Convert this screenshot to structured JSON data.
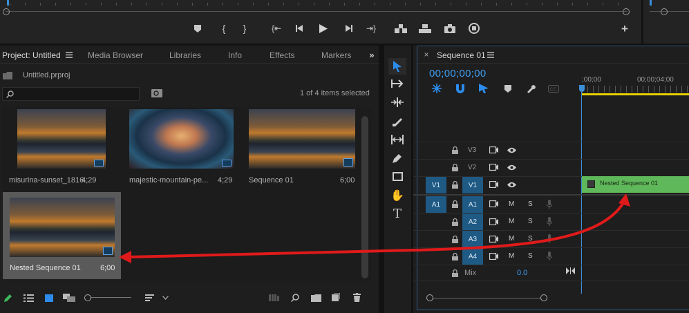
{
  "program_monitor": {
    "transport_icons": [
      "marker-icon",
      "mark-in-icon",
      "mark-out-icon",
      "go-to-in-icon",
      "step-back-icon",
      "play-icon",
      "step-forward-icon",
      "go-to-out-icon",
      "insert-icon",
      "overwrite-icon",
      "export-frame-icon",
      "comparison-view-icon",
      "add-button-icon"
    ]
  },
  "project_panel": {
    "tabs": [
      "Project: Untitled",
      "Media Browser",
      "Libraries",
      "Info",
      "Effects",
      "Markers"
    ],
    "file_name": "Untitled.prproj",
    "search_placeholder": "",
    "selection_status": "1 of 4 items selected",
    "items": [
      {
        "name": "misurina-sunset_1816...",
        "duration": "4;29",
        "type": "video"
      },
      {
        "name": "majestic-mountain-pe...",
        "duration": "4;29",
        "type": "video"
      },
      {
        "name": "Sequence 01",
        "duration": "6;00",
        "type": "sequence"
      },
      {
        "name": "Nested Sequence 01",
        "duration": "6;00",
        "type": "sequence",
        "selected": true
      }
    ]
  },
  "timeline": {
    "sequence_tab": "Sequence 01",
    "timecode": "00;00;00;00",
    "ruler_labels": [
      ";00;00",
      "00;00;04;00"
    ],
    "video_tracks": [
      {
        "label": "V3",
        "source": ""
      },
      {
        "label": "V2",
        "source": ""
      },
      {
        "label": "V1",
        "source": "V1"
      }
    ],
    "audio_tracks": [
      {
        "label": "A1",
        "source": "A1"
      },
      {
        "label": "A2",
        "source": ""
      },
      {
        "label": "A3",
        "source": ""
      },
      {
        "label": "A4",
        "source": ""
      }
    ],
    "mix_label": "Mix",
    "mix_value": "0.0",
    "m_label": "M",
    "s_label": "S",
    "clip_name": "Nested Sequence 01",
    "colors": {
      "accent_blue": "#2d8ceb",
      "clip_green": "#5fb85a",
      "arrow_red": "#e01a1a",
      "playhead": "#3a8fd8"
    }
  }
}
